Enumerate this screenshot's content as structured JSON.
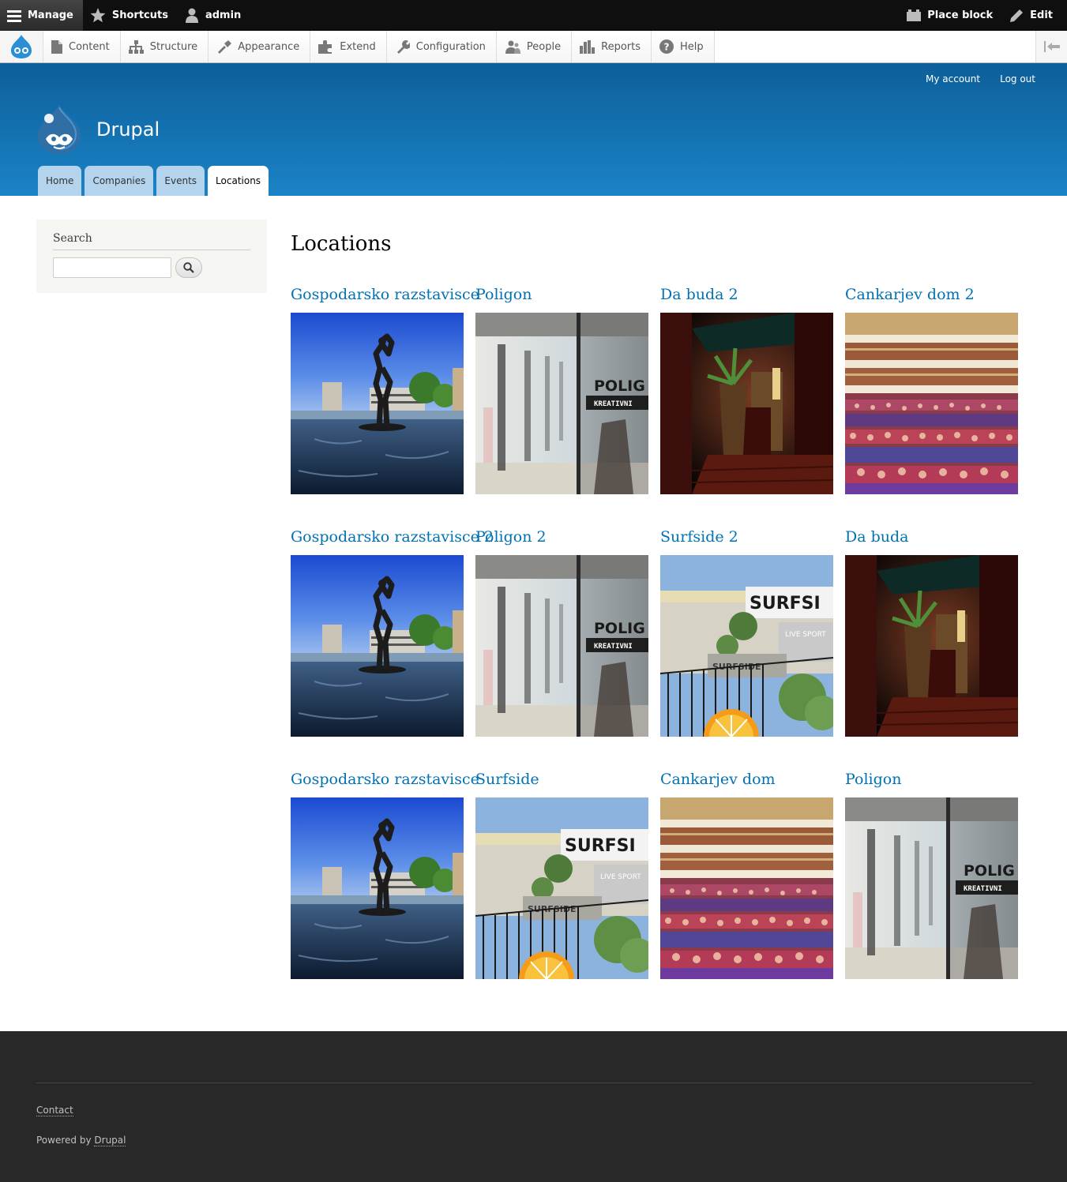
{
  "toolbar": {
    "manage": "Manage",
    "shortcuts": "Shortcuts",
    "user": "admin",
    "place_block": "Place block",
    "edit": "Edit"
  },
  "tray": {
    "items": [
      "Content",
      "Structure",
      "Appearance",
      "Extend",
      "Configuration",
      "People",
      "Reports",
      "Help"
    ]
  },
  "header": {
    "site_name": "Drupal",
    "my_account": "My account",
    "log_out": "Log out",
    "tabs": [
      "Home",
      "Companies",
      "Events",
      "Locations"
    ],
    "active_tab": "Locations"
  },
  "sidebar": {
    "search_title": "Search",
    "search_value": ""
  },
  "main": {
    "title": "Locations",
    "locations": [
      {
        "title": "Gospodarsko razstavisce",
        "image": "statue-fountain"
      },
      {
        "title": "Poligon",
        "image": "poligon-hall"
      },
      {
        "title": "Da buda 2",
        "image": "dark-room"
      },
      {
        "title": "Cankarjev dom 2",
        "image": "auditorium"
      },
      {
        "title": "Gospodarsko razstavisce 2",
        "image": "statue-fountain"
      },
      {
        "title": "Poligon 2",
        "image": "poligon-hall"
      },
      {
        "title": "Surfside 2",
        "image": "surfside-terrace"
      },
      {
        "title": "Da buda",
        "image": "dark-room"
      },
      {
        "title": "Gospodarsko razstavisce",
        "image": "statue-fountain"
      },
      {
        "title": "Surfside",
        "image": "surfside-terrace"
      },
      {
        "title": "Cankarjev dom",
        "image": "auditorium"
      },
      {
        "title": "Poligon",
        "image": "poligon-hall"
      }
    ]
  },
  "footer": {
    "contact": "Contact",
    "powered_by": "Powered by",
    "powered_link": "Drupal"
  },
  "colors": {
    "link": "#0071b3",
    "header_top": "#0d5f9a",
    "header_bottom": "#1a83c6",
    "footer": "#292828"
  }
}
